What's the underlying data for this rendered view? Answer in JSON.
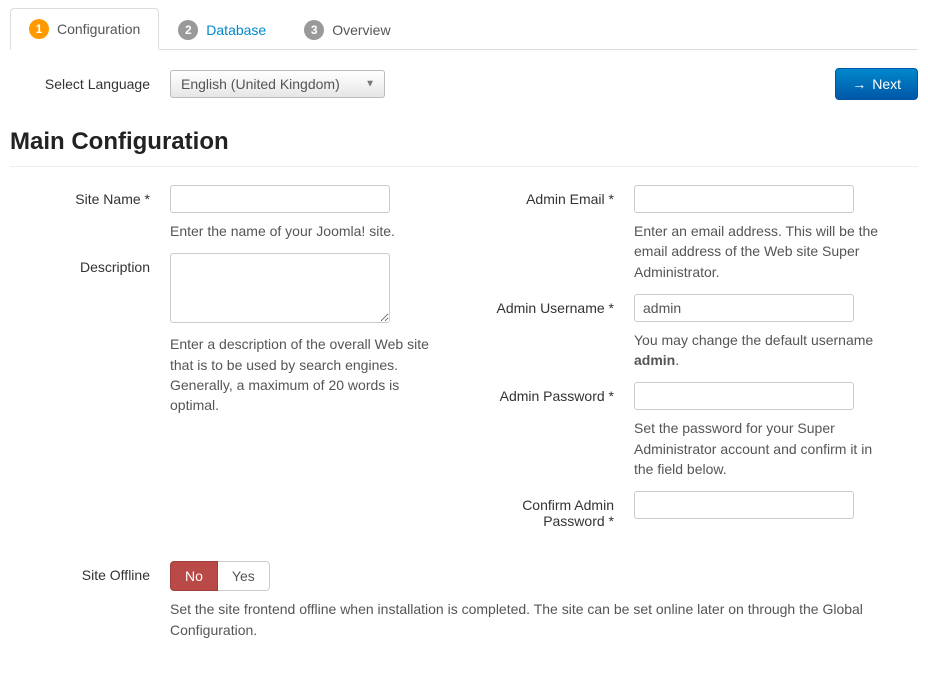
{
  "tabs": [
    {
      "num": "1",
      "label": "Configuration"
    },
    {
      "num": "2",
      "label": "Database"
    },
    {
      "num": "3",
      "label": "Overview"
    }
  ],
  "toolbar": {
    "select_language_label": "Select Language",
    "language_value": "English (United Kingdom)",
    "next_label": "Next"
  },
  "heading": "Main Configuration",
  "left": {
    "site_name_label": "Site Name *",
    "site_name_value": "",
    "site_name_help": "Enter the name of your Joomla! site.",
    "description_label": "Description",
    "description_value": "",
    "description_help": "Enter a description of the overall Web site that is to be used by search engines. Generally, a maximum of 20 words is optimal."
  },
  "right": {
    "admin_email_label": "Admin Email *",
    "admin_email_value": "",
    "admin_email_help": "Enter an email address. This will be the email address of the Web site Super Administrator.",
    "admin_username_label": "Admin Username *",
    "admin_username_value": "admin",
    "admin_username_help_pre": "You may change the default username ",
    "admin_username_help_strong": "admin",
    "admin_username_help_post": ".",
    "admin_password_label": "Admin Password *",
    "admin_password_value": "",
    "admin_password_help": "Set the password for your Super Administrator account and confirm it in the field below.",
    "confirm_password_label": "Confirm Admin Password *",
    "confirm_password_value": ""
  },
  "offline": {
    "label": "Site Offline",
    "no": "No",
    "yes": "Yes",
    "help": "Set the site frontend offline when installation is completed. The site can be set online later on through the Global Configuration."
  }
}
